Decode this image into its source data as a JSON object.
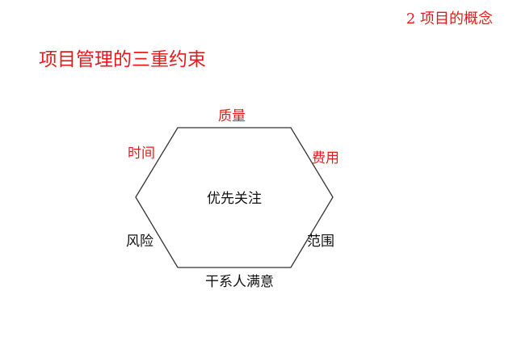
{
  "header": {
    "section_title": "2  项目的概念"
  },
  "slide": {
    "title": "项目管理的三重约束"
  },
  "diagram": {
    "center": "优先关注",
    "edges": {
      "top": "质量",
      "upper_left": "时间",
      "upper_right": "费用",
      "lower_left": "风险",
      "lower_right": "范围",
      "bottom": "干系人满意"
    },
    "colors": {
      "highlight": "#e41a1c",
      "normal": "#111111",
      "outline": "#333333"
    }
  }
}
